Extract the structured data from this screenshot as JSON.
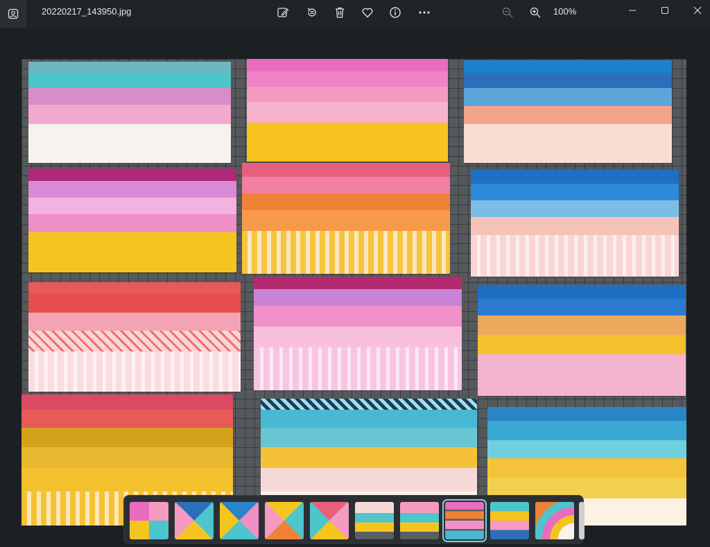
{
  "titlebar": {
    "filename": "20220217_143950.jpg",
    "zoom_label": "100%"
  },
  "toolbar": {
    "icons": [
      "edit-image-icon",
      "rotate-icon",
      "delete-icon",
      "favorite-icon",
      "info-icon",
      "more-icon",
      "zoom-out-icon",
      "zoom-in-icon"
    ]
  },
  "window_controls": [
    "minimize-icon",
    "maximize-icon",
    "close-icon"
  ],
  "colors": {
    "titlebar_bg": "#202427",
    "window_bg": "#1c2023",
    "accent_selected": "#7fd1e6"
  },
  "filmstrip": {
    "thumbnail_count": 11,
    "selected_index": 7
  }
}
